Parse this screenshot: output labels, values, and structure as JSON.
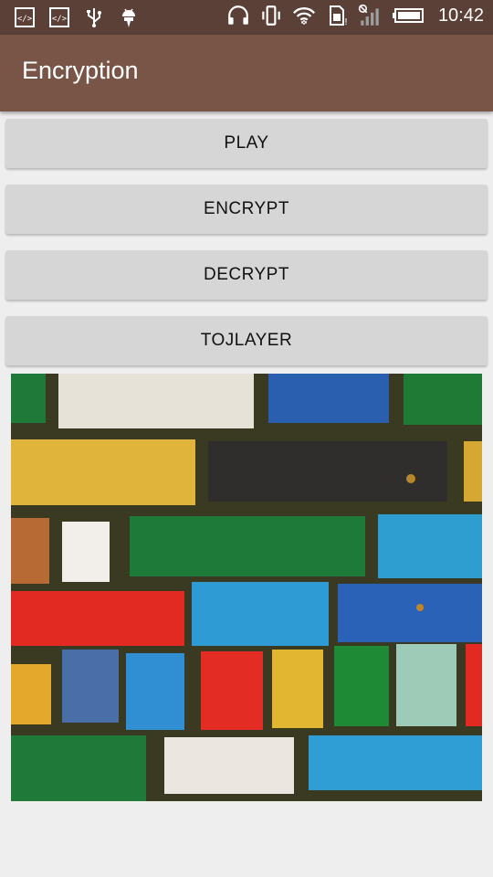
{
  "status_bar": {
    "time": "10:42",
    "icons": [
      "code-icon",
      "code-icon",
      "usb-icon",
      "android-icon",
      "headset-icon",
      "vibrate-icon",
      "wifi-icon",
      "sim-icon",
      "signal-icon",
      "battery-icon"
    ]
  },
  "app_bar": {
    "title": "Encryption"
  },
  "buttons": {
    "play": "PLAY",
    "encrypt": "ENCRYPT",
    "decrypt": "DECRYPT",
    "toplayer": "TOJLAYER"
  },
  "image": {
    "subject": "colorful painted brick wall"
  },
  "colors": {
    "status_bar": "#5a4036",
    "app_bar": "#795548",
    "button": "#d6d6d6",
    "background": "#eeeeee"
  }
}
